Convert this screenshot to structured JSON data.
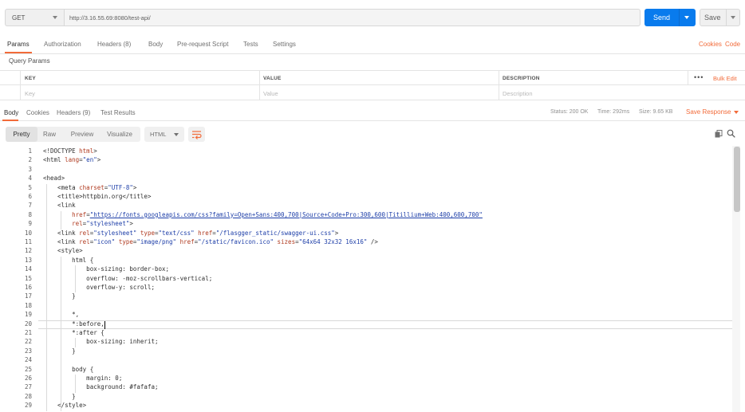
{
  "request": {
    "method": "GET",
    "url": "http://3.16.55.69:8080/test-api/",
    "send_label": "Send",
    "save_label": "Save"
  },
  "request_tabs": [
    "Params",
    "Authorization",
    "Headers (8)",
    "Body",
    "Pre-request Script",
    "Tests",
    "Settings"
  ],
  "request_links": {
    "cookies": "Cookies",
    "code": "Code"
  },
  "query_params": {
    "title": "Query Params",
    "headers": [
      "KEY",
      "VALUE",
      "DESCRIPTION"
    ],
    "placeholders": [
      "Key",
      "Value",
      "Description"
    ],
    "more": "•••",
    "bulk_edit": "Bulk Edit"
  },
  "response_tabs": [
    "Body",
    "Cookies",
    "Headers (9)",
    "Test Results"
  ],
  "response_status": {
    "status": "Status: 200 OK",
    "time": "Time: 292ms",
    "size": "Size: 9.65 KB",
    "save_response": "Save Response"
  },
  "view_modes": [
    "Pretty",
    "Raw",
    "Preview",
    "Visualize"
  ],
  "format": "HTML",
  "icons": [
    "caret-down-icon",
    "wrap-lines-icon",
    "copy-icon",
    "search-icon"
  ],
  "accent_color": "#f26b3a",
  "send_color": "#097bed",
  "code_lines": [
    [
      [
        "t",
        "<!DOCTYPE "
      ],
      [
        "a",
        "html"
      ],
      [
        "t",
        ">"
      ]
    ],
    [
      [
        "t",
        "<html "
      ],
      [
        "a",
        "lang"
      ],
      [
        "t",
        "="
      ],
      [
        "v",
        "\"en\""
      ],
      [
        "t",
        ">"
      ]
    ],
    [],
    [
      [
        "t",
        "<head>"
      ]
    ],
    [
      [
        "t",
        "    <meta "
      ],
      [
        "a",
        "charset"
      ],
      [
        "t",
        "="
      ],
      [
        "v",
        "\"UTF-8\""
      ],
      [
        "t",
        ">"
      ]
    ],
    [
      [
        "t",
        "    <title>httpbin.org</title>"
      ]
    ],
    [
      [
        "t",
        "    <link"
      ]
    ],
    [
      [
        "t",
        "        "
      ],
      [
        "a",
        "href"
      ],
      [
        "t",
        "="
      ],
      [
        "u",
        "\"https://fonts.googleapis.com/css?family=Open+Sans:400,700|Source+Code+Pro:300,600|Titillium+Web:400,600,700\""
      ]
    ],
    [
      [
        "t",
        "        "
      ],
      [
        "a",
        "rel"
      ],
      [
        "t",
        "="
      ],
      [
        "v",
        "\"stylesheet\""
      ],
      [
        "t",
        ">"
      ]
    ],
    [
      [
        "t",
        "    <link "
      ],
      [
        "a",
        "rel"
      ],
      [
        "t",
        "="
      ],
      [
        "v",
        "\"stylesheet\""
      ],
      [
        "t",
        " "
      ],
      [
        "a",
        "type"
      ],
      [
        "t",
        "="
      ],
      [
        "v",
        "\"text/css\""
      ],
      [
        "t",
        " "
      ],
      [
        "a",
        "href"
      ],
      [
        "t",
        "="
      ],
      [
        "v",
        "\"/flasgger_static/swagger-ui.css\""
      ],
      [
        "t",
        ">"
      ]
    ],
    [
      [
        "t",
        "    <link "
      ],
      [
        "a",
        "rel"
      ],
      [
        "t",
        "="
      ],
      [
        "v",
        "\"icon\""
      ],
      [
        "t",
        " "
      ],
      [
        "a",
        "type"
      ],
      [
        "t",
        "="
      ],
      [
        "v",
        "\"image/png\""
      ],
      [
        "t",
        " "
      ],
      [
        "a",
        "href"
      ],
      [
        "t",
        "="
      ],
      [
        "v",
        "\"/static/favicon.ico\""
      ],
      [
        "t",
        " "
      ],
      [
        "a",
        "sizes"
      ],
      [
        "t",
        "="
      ],
      [
        "v",
        "\"64x64 32x32 16x16\""
      ],
      [
        "t",
        " />"
      ]
    ],
    [
      [
        "t",
        "    <style>"
      ]
    ],
    [
      [
        "t",
        "        html {"
      ]
    ],
    [
      [
        "t",
        "            box-sizing: border-box;"
      ]
    ],
    [
      [
        "t",
        "            overflow: -moz-scrollbars-vertical;"
      ]
    ],
    [
      [
        "t",
        "            overflow-y: scroll;"
      ]
    ],
    [
      [
        "t",
        "        }"
      ]
    ],
    [],
    [
      [
        "t",
        "        *,"
      ]
    ],
    [
      [
        "t",
        "        *:before,"
      ]
    ],
    [
      [
        "t",
        "        *:after {"
      ]
    ],
    [
      [
        "t",
        "            box-sizing: inherit;"
      ]
    ],
    [
      [
        "t",
        "        }"
      ]
    ],
    [],
    [
      [
        "t",
        "        body {"
      ]
    ],
    [
      [
        "t",
        "            margin: 0;"
      ]
    ],
    [
      [
        "t",
        "            background: #fafafa;"
      ]
    ],
    [
      [
        "t",
        "        }"
      ]
    ],
    [
      [
        "t",
        "    </style>"
      ]
    ]
  ]
}
